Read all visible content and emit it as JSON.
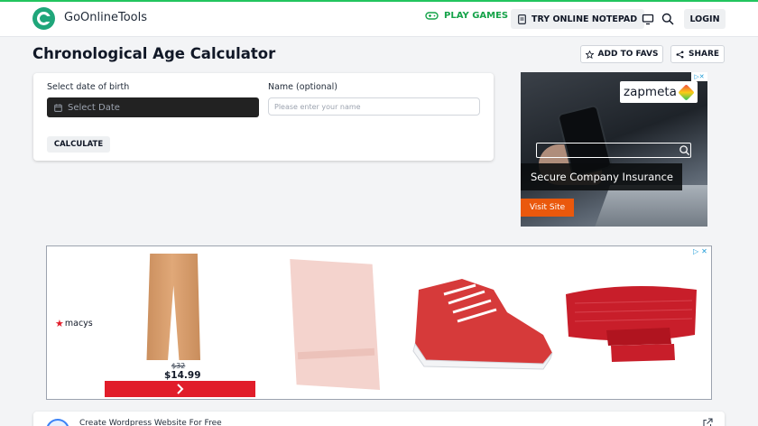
{
  "header": {
    "brand": "GoOnlineTools",
    "play_games": "PLAY GAMES",
    "notepad": "TRY ONLINE NOTEPAD",
    "login": "LOGIN",
    "accent_color": "#16a34a"
  },
  "page": {
    "title": "Chronological Age Calculator",
    "add_to_favs": "ADD TO FAVS",
    "share": "SHARE"
  },
  "calculator": {
    "dob_label": "Select date of birth",
    "dob_placeholder": "Select Date",
    "name_label": "Name (optional)",
    "name_placeholder": "Please enter your name",
    "name_value": "",
    "calculate": "CALCULATE"
  },
  "ad_right": {
    "brand": "zapmeta",
    "headline": "Secure Company Insurance",
    "cta": "Visit Site"
  },
  "ad_bottom": {
    "brand": "macys",
    "old_price": "$32",
    "new_price": "$14.99"
  },
  "strip": {
    "text": "Create Wordpress Website For Free"
  },
  "icons": [
    "gamepad-icon",
    "notepad-icon",
    "monitor-icon",
    "search-icon",
    "star-icon",
    "share-icon",
    "calendar-icon",
    "adchoices-icon",
    "external-link-icon"
  ]
}
